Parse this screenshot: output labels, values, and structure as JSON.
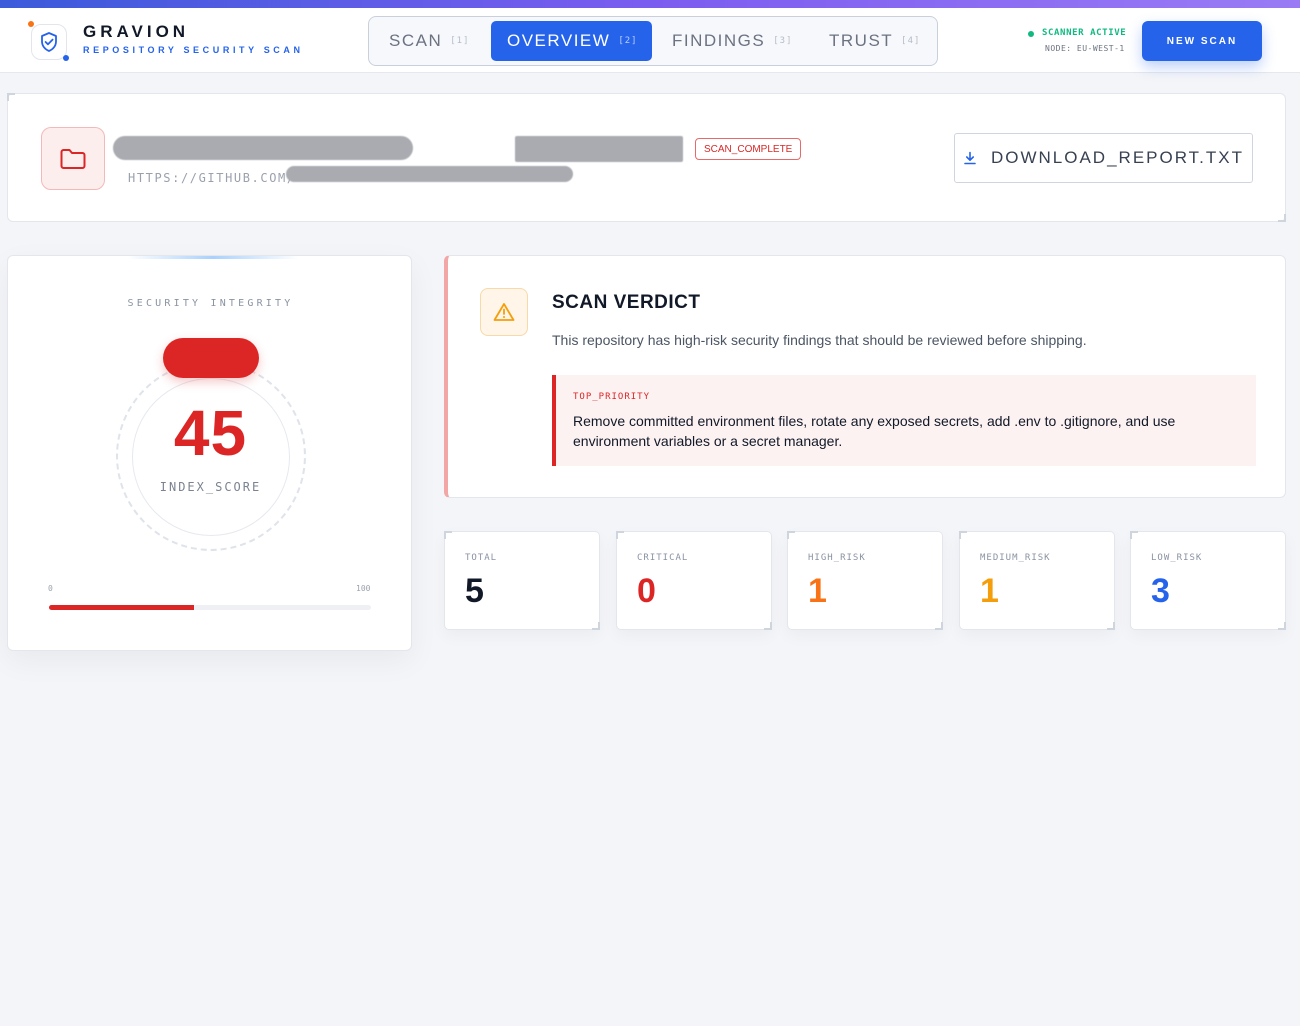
{
  "brand": {
    "name": "GRAVION",
    "subtitle": "REPOSITORY SECURITY SCAN"
  },
  "nav": {
    "tabs": [
      {
        "label": "SCAN",
        "index": "[1]",
        "active": false
      },
      {
        "label": "OVERVIEW",
        "index": "[2]",
        "active": true
      },
      {
        "label": "FINDINGS",
        "index": "[3]",
        "active": false
      },
      {
        "label": "TRUST",
        "index": "[4]",
        "active": false
      }
    ]
  },
  "status": {
    "text": "SCANNER ACTIVE",
    "node": "NODE: EU-WEST-1",
    "color": "#10b981"
  },
  "actions": {
    "new_scan": "NEW SCAN",
    "download": "DOWNLOAD_REPORT.TXT"
  },
  "repo": {
    "url": "HTTPS://GITHUB.COM/",
    "badge": "SCAN_COMPLETE"
  },
  "score": {
    "label": "SECURITY INTEGRITY",
    "value": "45",
    "caption": "INDEX_SCORE",
    "min": "0",
    "max": "100",
    "fraction": 0.45
  },
  "verdict": {
    "title": "SCAN VERDICT",
    "description": "This repository has high-risk security findings that should be reviewed before shipping.",
    "priority_label": "TOP_PRIORITY",
    "priority_text": "Remove committed environment files, rotate any exposed secrets, add .env to .gitignore, and use environment variables or a secret manager."
  },
  "stats": [
    {
      "label": "TOTAL",
      "value": "5",
      "color": "#111827"
    },
    {
      "label": "CRITICAL",
      "value": "0",
      "color": "#dc2626"
    },
    {
      "label": "HIGH_RISK",
      "value": "1",
      "color": "#f97316"
    },
    {
      "label": "MEDIUM_RISK",
      "value": "1",
      "color": "#f59e0b"
    },
    {
      "label": "LOW_RISK",
      "value": "3",
      "color": "#2563eb"
    }
  ],
  "colors": {
    "accent": "#2563eb",
    "danger": "#dc2626",
    "warning": "#f59e0b"
  },
  "icons": [
    "shield-check-icon",
    "folder-icon",
    "download-icon",
    "warning-triangle-icon"
  ]
}
